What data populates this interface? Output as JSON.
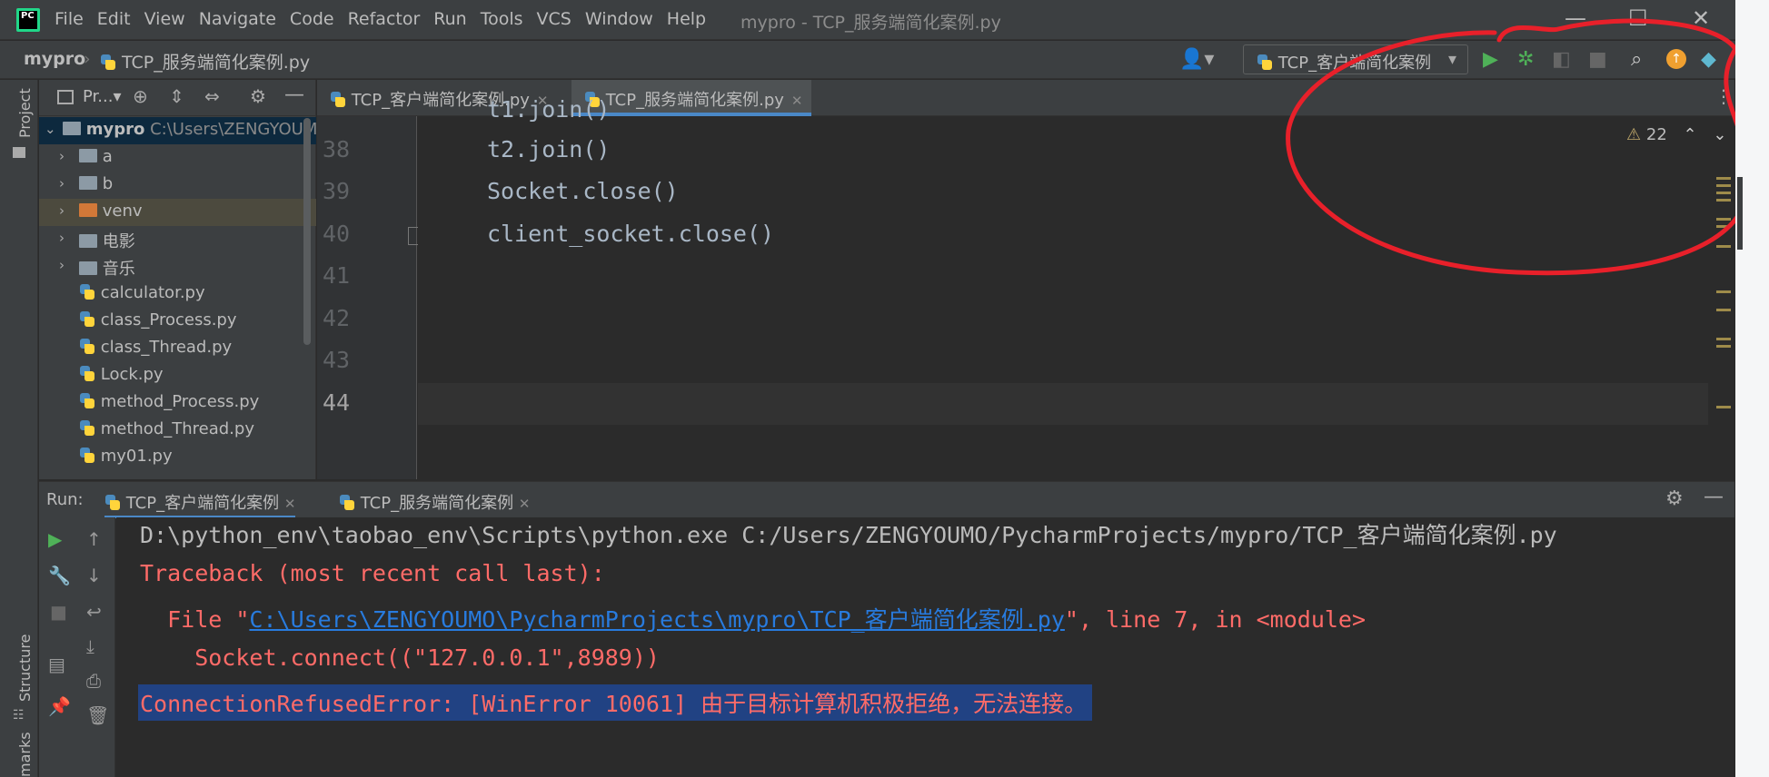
{
  "menu": [
    "File",
    "Edit",
    "View",
    "Navigate",
    "Code",
    "Refactor",
    "Run",
    "Tools",
    "VCS",
    "Window",
    "Help"
  ],
  "window_title": "mypro - TCP_服务端简化案例.py",
  "breadcrumb": {
    "project": "mypro",
    "file": "TCP_服务端简化案例.py"
  },
  "run_config": "TCP_客户端简化案例",
  "project_panel": {
    "title": "Pr...",
    "root": {
      "name": "mypro",
      "path": "C:\\Users\\ZENGYOUMO"
    },
    "items": [
      {
        "name": "a",
        "type": "folder"
      },
      {
        "name": "b",
        "type": "folder"
      },
      {
        "name": "venv",
        "type": "folder-orange"
      },
      {
        "name": "电影",
        "type": "folder"
      },
      {
        "name": "音乐",
        "type": "folder"
      },
      {
        "name": "calculator.py",
        "type": "py"
      },
      {
        "name": "class_Process.py",
        "type": "py"
      },
      {
        "name": "class_Thread.py",
        "type": "py"
      },
      {
        "name": "Lock.py",
        "type": "py"
      },
      {
        "name": "method_Process.py",
        "type": "py"
      },
      {
        "name": "method_Thread.py",
        "type": "py"
      },
      {
        "name": "my01.py",
        "type": "py"
      }
    ]
  },
  "editor": {
    "tabs": [
      {
        "label": "TCP_客户端简化案例.py",
        "active": false
      },
      {
        "label": "TCP_服务端简化案例.py",
        "active": true
      }
    ],
    "warning_count": "22",
    "lines": [
      {
        "num": "38",
        "code": "t2.join()"
      },
      {
        "num": "39",
        "code": "Socket.close()"
      },
      {
        "num": "40",
        "code": "client_socket.close()"
      },
      {
        "num": "41",
        "code": ""
      },
      {
        "num": "42",
        "code": ""
      },
      {
        "num": "43",
        "code": ""
      },
      {
        "num": "44",
        "code": ""
      }
    ]
  },
  "run": {
    "label": "Run:",
    "tabs": [
      "TCP_客户端简化案例",
      "TCP_服务端简化案例"
    ],
    "console": {
      "cmd": "D:\\python_env\\taobao_env\\Scripts\\python.exe C:/Users/ZENGYOUMO/PycharmProjects/mypro/TCP_客户端简化案例.py",
      "traceback": "Traceback (most recent call last):",
      "file_prefix": "  File \"",
      "file_link": "C:\\Users\\ZENGYOUMO\\PycharmProjects\\mypro\\TCP_客户端简化案例.py",
      "file_suffix": "\", line 7, in <module>",
      "code_line": "    Socket.connect((\"127.0.0.1\",8989))",
      "error": "ConnectionRefusedError: [WinError 10061] 由于目标计算机积极拒绝，无法连接。"
    }
  },
  "side_labels": {
    "project": "Project",
    "structure": "Structure",
    "bookmarks": "marks"
  },
  "colors": {
    "accent": "#4a88c7",
    "error": "#ff6b68",
    "link": "#287bde",
    "annotation": "#e8202a"
  }
}
